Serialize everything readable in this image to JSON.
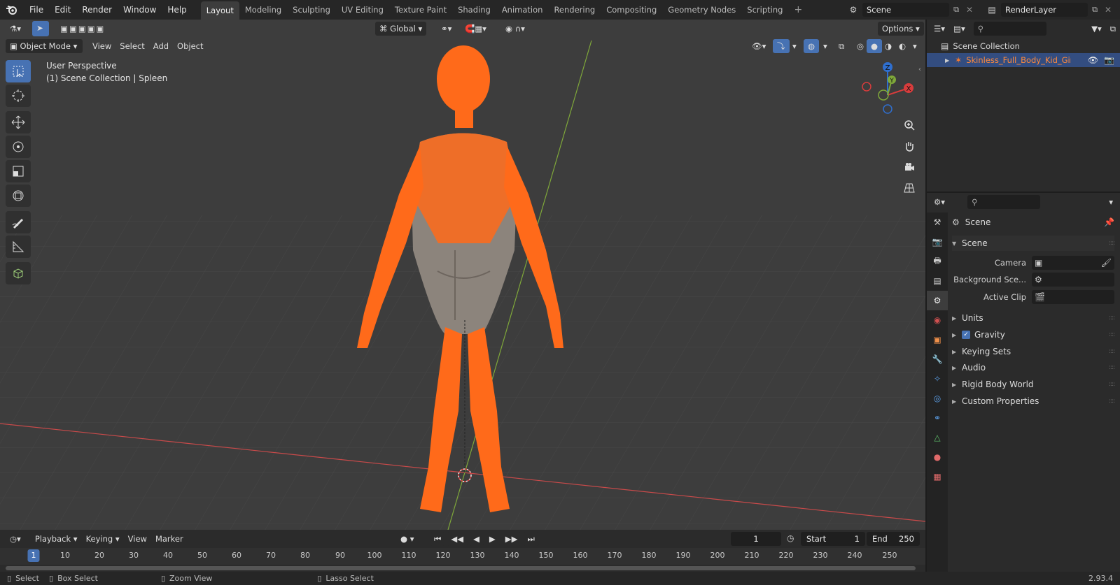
{
  "menu": {
    "items": [
      "File",
      "Edit",
      "Render",
      "Window",
      "Help"
    ]
  },
  "workspaces": [
    "Layout",
    "Modeling",
    "Sculpting",
    "UV Editing",
    "Texture Paint",
    "Shading",
    "Animation",
    "Rendering",
    "Compositing",
    "Geometry Nodes",
    "Scripting"
  ],
  "scene_field": "Scene",
  "render_layer_field": "RenderLayer",
  "viewport": {
    "transform_orientation": "Global",
    "options_label": "Options",
    "mode": "Object Mode",
    "header_menus": [
      "View",
      "Select",
      "Add",
      "Object"
    ],
    "info_line1": "User Perspective",
    "info_line2": "(1) Scene Collection | Spleen",
    "gizmo_labels": {
      "z": "Z",
      "y": "Y",
      "x": "X"
    }
  },
  "outliner": {
    "root": "Scene Collection",
    "item": "Skinless_Full_Body_Kid_Girl_"
  },
  "properties": {
    "context": "Scene",
    "panel_title": "Scene",
    "fields": [
      {
        "label": "Camera"
      },
      {
        "label": "Background Sce..."
      },
      {
        "label": "Active Clip"
      }
    ],
    "sections": [
      "Units",
      "Gravity",
      "Keying Sets",
      "Audio",
      "Rigid Body World",
      "Custom Properties"
    ]
  },
  "timeline": {
    "menus": [
      "Playback",
      "Keying",
      "View",
      "Marker"
    ],
    "current_frame": "1",
    "start_label": "Start",
    "start_value": "1",
    "end_label": "End",
    "end_value": "250",
    "ruler_ticks": [
      "1",
      "10",
      "20",
      "30",
      "40",
      "50",
      "60",
      "70",
      "80",
      "90",
      "100",
      "110",
      "120",
      "130",
      "140",
      "150",
      "160",
      "170",
      "180",
      "190",
      "200",
      "210",
      "220",
      "230",
      "240",
      "250"
    ]
  },
  "statusbar": {
    "select": "Select",
    "box_select": "Box Select",
    "zoom_view": "Zoom View",
    "lasso_select": "Lasso Select",
    "version": "2.93.4"
  },
  "colors": {
    "accent": "#4772b3",
    "selection": "#ff6a1a",
    "x_axis": "#c94a4a",
    "y_axis": "#7fa83a"
  }
}
